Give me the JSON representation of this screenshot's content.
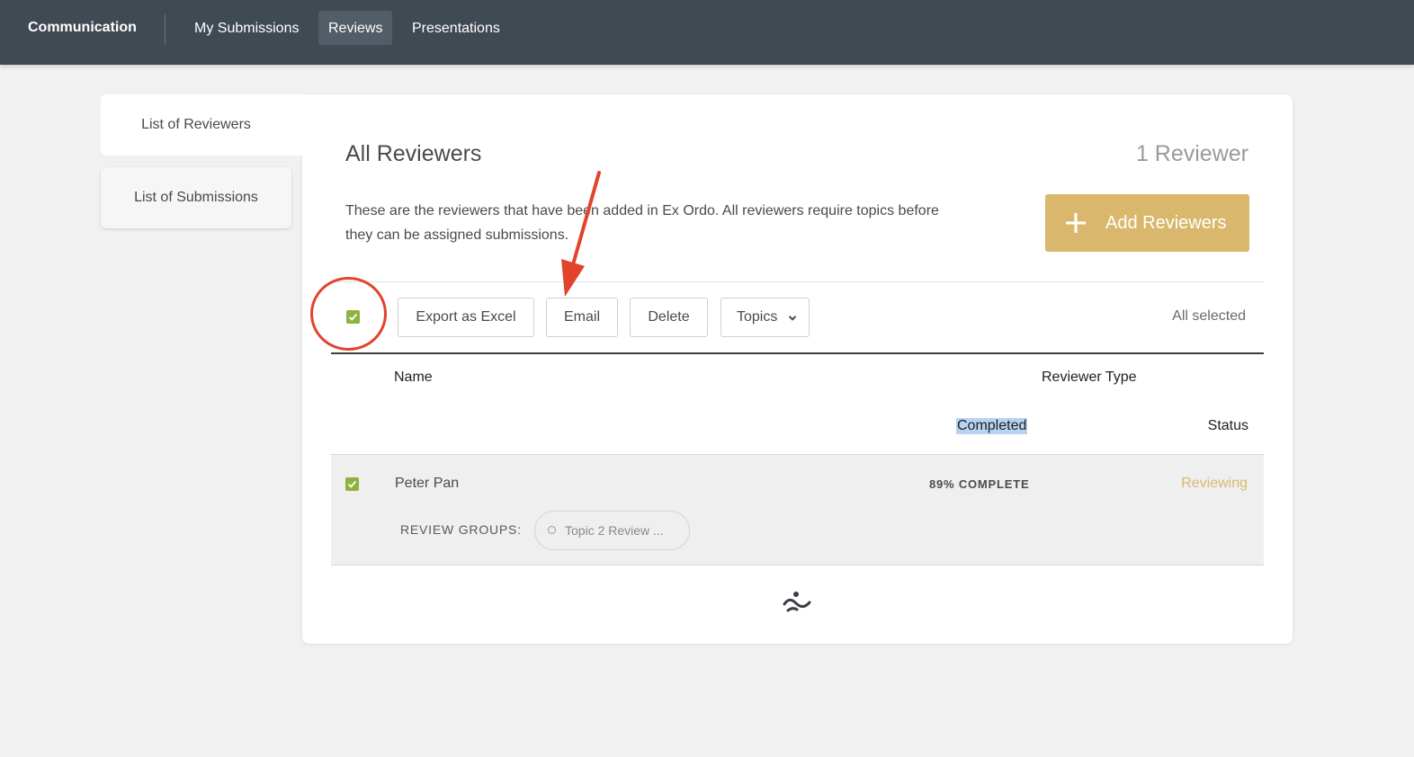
{
  "app": {
    "brand": "Communication",
    "nav": [
      {
        "label": "My Submissions",
        "active": false
      },
      {
        "label": "Reviews",
        "active": true
      },
      {
        "label": "Presentations",
        "active": false
      }
    ]
  },
  "sidebar": {
    "tabs": [
      {
        "label": "List of Reviewers",
        "active": true
      },
      {
        "label": "List of Submissions",
        "active": false
      }
    ]
  },
  "main": {
    "title": "All Reviewers",
    "count": "1 Reviewer",
    "description": "These are the reviewers that have been added in Ex Ordo. All reviewers require topics before they can be assigned submissions.",
    "add_button": "Add Reviewers",
    "toolbar": {
      "select_all_checked": true,
      "export": "Export as Excel",
      "email": "Email",
      "delete": "Delete",
      "topics": "Topics",
      "selection_status": "All selected"
    },
    "columns": {
      "name": "Name",
      "reviewer_type": "Reviewer Type",
      "completed": "Completed",
      "status": "Status"
    },
    "rows": [
      {
        "checked": true,
        "name": "Peter Pan",
        "completed": "89% COMPLETE",
        "status": "Reviewing",
        "groups_label": "REVIEW GROUPS:",
        "groups": [
          "Topic 2 Review ..."
        ]
      }
    ]
  },
  "colors": {
    "topbar": "#404a53",
    "accent_gold": "#d9b86e",
    "checkbox_green": "#8cb33e",
    "annotation_red": "#e2432d"
  },
  "icons": {
    "add": "plus-icon",
    "topics_dropdown": "chevron-down-icon",
    "checkbox": "check-icon",
    "group": "dot-icon",
    "loader": "loader-icon"
  }
}
